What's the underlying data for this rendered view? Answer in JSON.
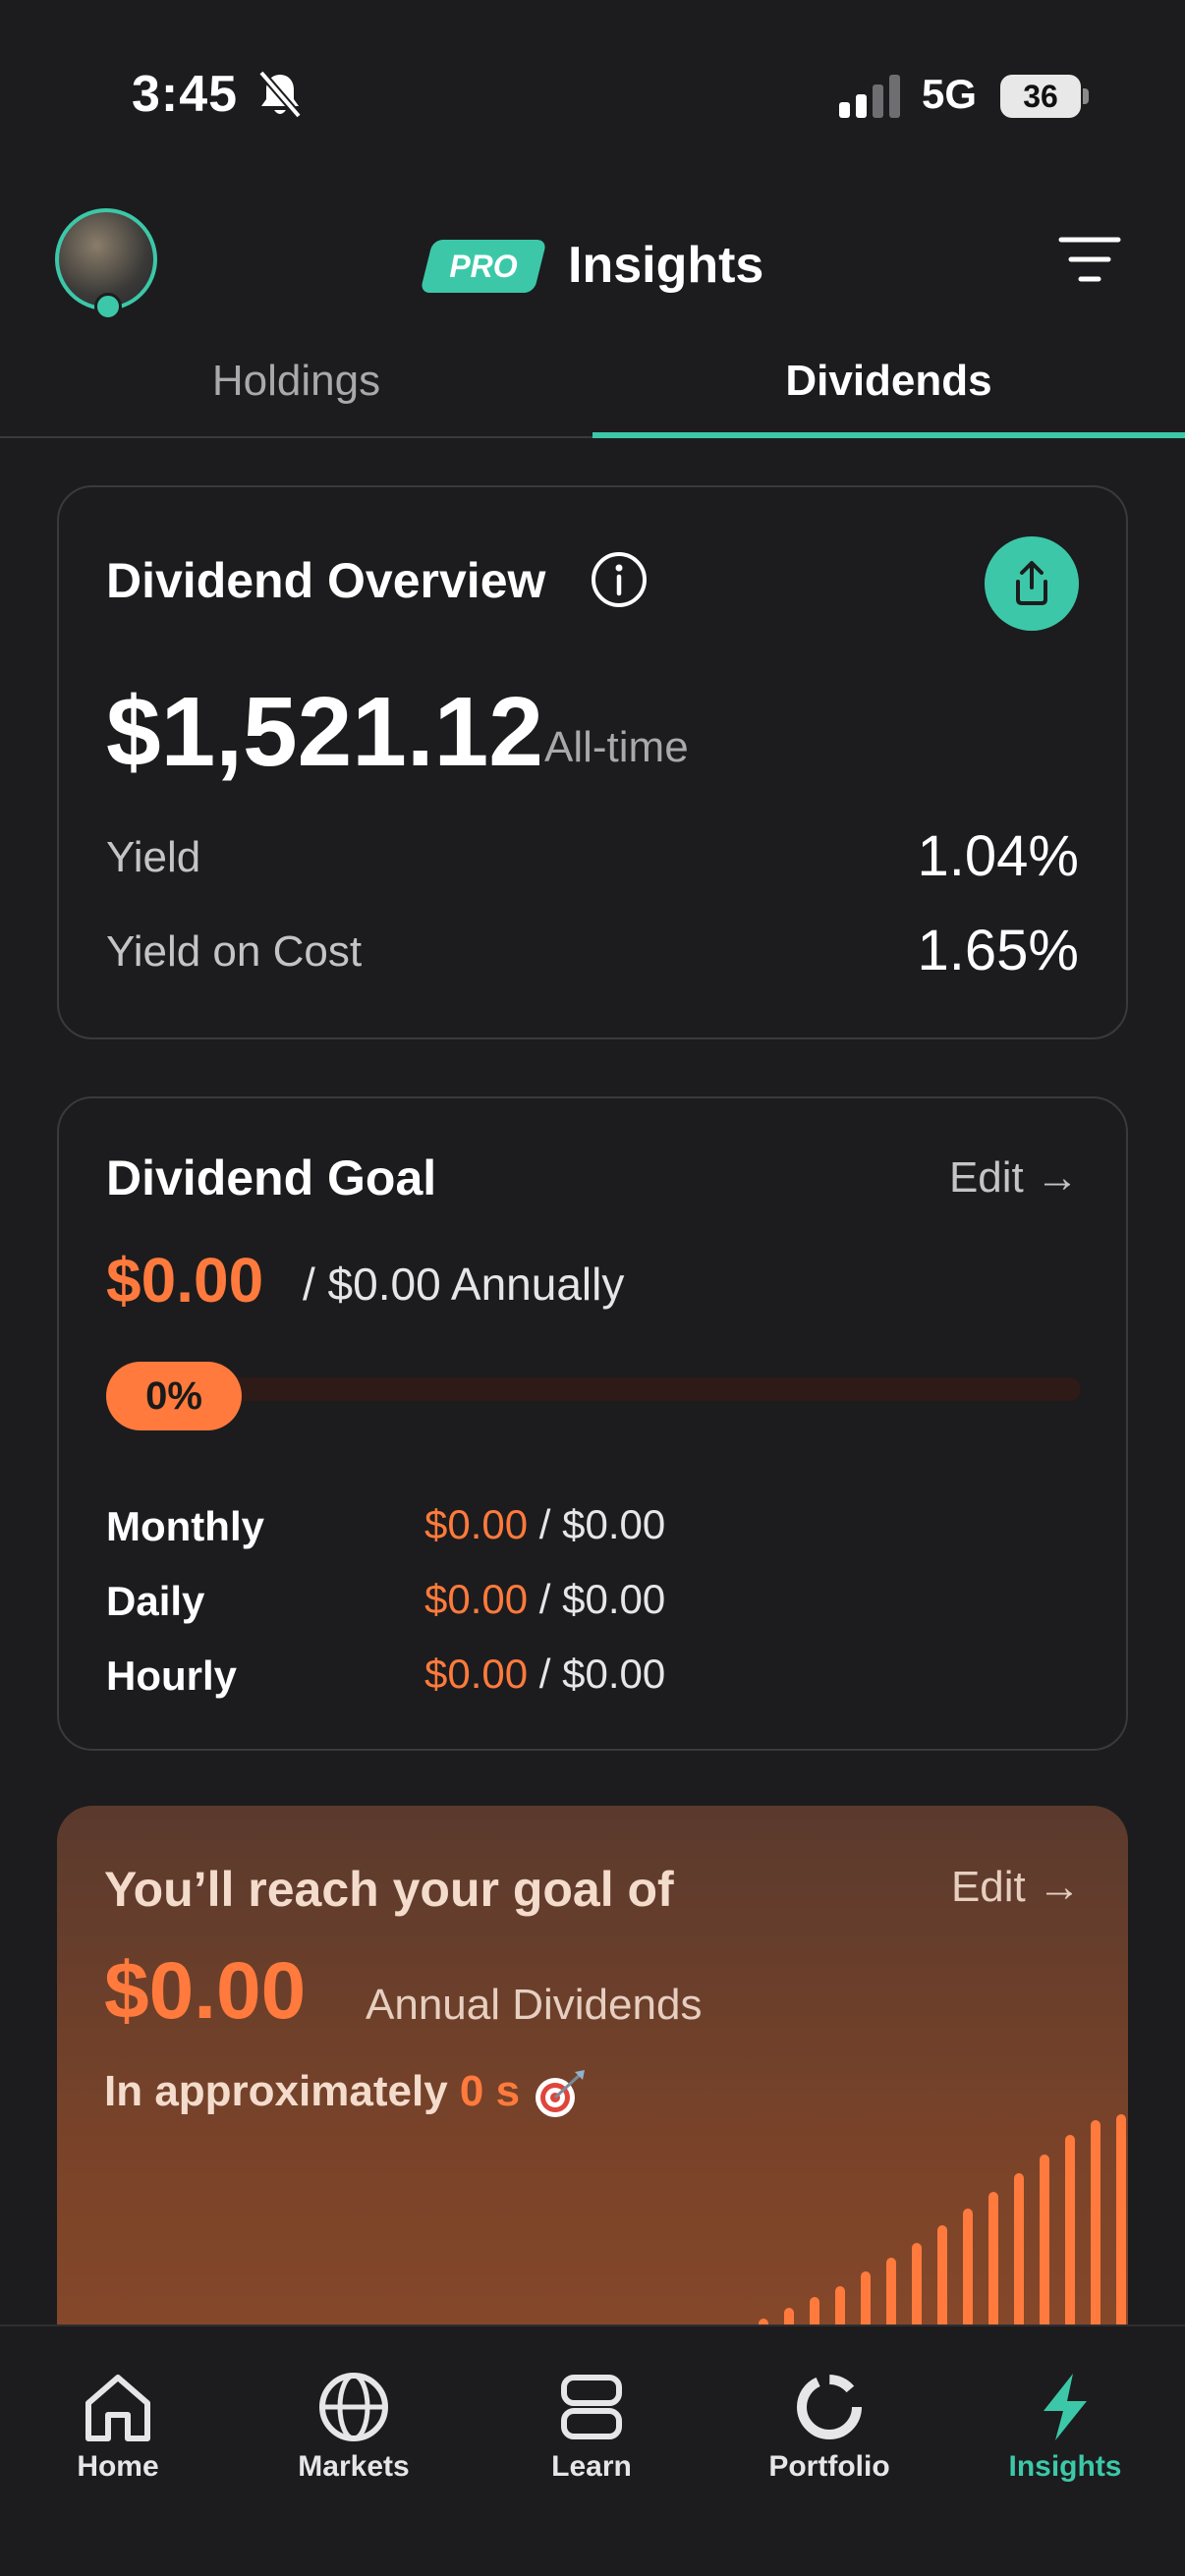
{
  "status_bar": {
    "time": "3:45",
    "network": "5G",
    "battery": "36",
    "icons": [
      "bell-muted-icon",
      "signal-icon",
      "battery-icon"
    ]
  },
  "header": {
    "badge": "PRO",
    "title": "Insights",
    "icons": [
      "avatar",
      "filter-icon"
    ]
  },
  "tabs": [
    {
      "label": "Holdings",
      "active": false
    },
    {
      "label": "Dividends",
      "active": true
    }
  ],
  "overview": {
    "title": "Dividend Overview",
    "total": "$1,521.12",
    "period": "All-time",
    "yield_label": "Yield",
    "yield_value": "1.04%",
    "yoc_label": "Yield on Cost",
    "yoc_value": "1.65%"
  },
  "goal": {
    "title": "Dividend Goal",
    "edit_label": "Edit →",
    "current": "$0.00",
    "target": "/ $0.00 Annually",
    "progress_label": "0%",
    "progress": 0,
    "rows": [
      {
        "label": "Monthly",
        "current": "$0.00",
        "target": " / $0.00"
      },
      {
        "label": "Daily",
        "current": "$0.00",
        "target": " / $0.00"
      },
      {
        "label": "Hourly",
        "current": "$0.00",
        "target": " / $0.00"
      }
    ]
  },
  "projection": {
    "title": "You’ll reach your goal of",
    "edit_label": "Edit →",
    "amount": "$0.00",
    "amount_label": "Annual Dividends",
    "eta_prefix": "In approximately ",
    "eta_value": "0 s",
    "bars": [
      0.03,
      0.08,
      0.13,
      0.18,
      0.25,
      0.32,
      0.39,
      0.47,
      0.55,
      0.63,
      0.72,
      0.81,
      0.9,
      0.97,
      1.0
    ]
  },
  "colors": {
    "accent": "#3cc8a8",
    "orange": "#ff7a3c",
    "background": "#1c1c1e"
  },
  "nav": [
    {
      "label": "Home",
      "icon": "home-icon",
      "active": false
    },
    {
      "label": "Markets",
      "icon": "globe-icon",
      "active": false
    },
    {
      "label": "Learn",
      "icon": "book-stack-icon",
      "active": false
    },
    {
      "label": "Portfolio",
      "icon": "donut-chart-icon",
      "active": false
    },
    {
      "label": "Insights",
      "icon": "lightning-icon",
      "active": true
    }
  ]
}
